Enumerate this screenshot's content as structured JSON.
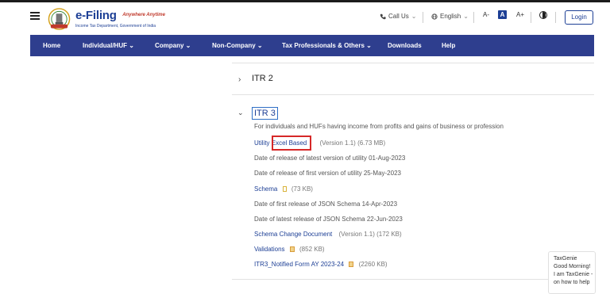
{
  "header": {
    "brand_title": "e-Filing",
    "brand_tagline": "Anywhere Anytime",
    "brand_subtitle": "Income Tax Department, Government of India",
    "call_us": "Call Us",
    "language": "English",
    "font_decrease": "A-",
    "font_normal": "A",
    "font_increase": "A+",
    "login": "Login"
  },
  "nav": {
    "items": [
      {
        "label": "Home"
      },
      {
        "label": "Individual/HUF ⌄"
      },
      {
        "label": "Company ⌄"
      },
      {
        "label": "Non-Company ⌄"
      },
      {
        "label": "Tax Professionals & Others ⌄"
      },
      {
        "label": "Downloads"
      },
      {
        "label": "Help"
      }
    ]
  },
  "content": {
    "itr2_title": "ITR 2",
    "itr3_title": "ITR 3",
    "itr3_description": "For individuals and HUFs having income from profits and gains of business or profession",
    "utility_link": "Utility Excel Based",
    "utility_meta": "(Version 1.1) (6.73 MB)",
    "latest_release": "Date of release of latest version of utility 01-Aug-2023",
    "first_release": "Date of release of first version of utility 25-May-2023",
    "schema_link": "Schema",
    "schema_meta": "(73 KB)",
    "json_first_release": "Date of first release of JSON Schema 14-Apr-2023",
    "json_latest_release": "Date of latest release of JSON Schema 22-Jun-2023",
    "schema_change_link": "Schema Change Document",
    "schema_change_meta": "(Version 1.1) (172 KB)",
    "validations_link": "Validations",
    "validations_meta": "(852 KB)",
    "notified_form_link": "ITR3_Notified Form AY 2023-24",
    "notified_form_meta": "(2260 KB)"
  },
  "chat": {
    "line1": "TaxGenie",
    "line2": "Good Morning!",
    "line3": "I am TaxGenie -",
    "line4": "on how to help"
  },
  "colors": {
    "brand_blue": "#1d3f95",
    "nav_bg": "#2e3e8e",
    "highlight_red": "#d62828"
  }
}
